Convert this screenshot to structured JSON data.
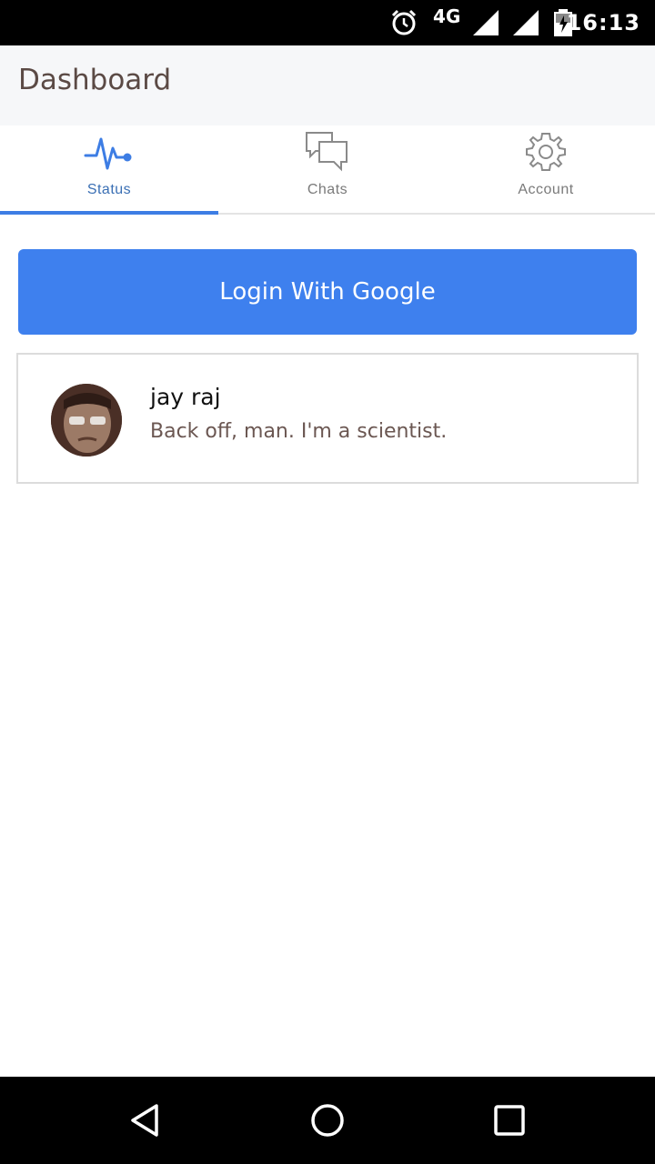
{
  "status_bar": {
    "network": "4G",
    "time": "16:13",
    "icons": [
      "alarm-icon",
      "signal-icon",
      "signal-icon",
      "battery-charging-icon"
    ]
  },
  "app_bar": {
    "title": "Dashboard"
  },
  "tabs": [
    {
      "label": "Status",
      "icon": "pulse-icon",
      "active": true
    },
    {
      "label": "Chats",
      "icon": "chat-bubbles-icon",
      "active": false
    },
    {
      "label": "Account",
      "icon": "gear-icon",
      "active": false
    }
  ],
  "login": {
    "label": "Login With Google"
  },
  "status_card": {
    "name": "jay raj",
    "status": "Back off, man. I'm a scientist."
  },
  "nav_bar": {
    "icons": [
      "back-icon",
      "home-icon",
      "recents-icon"
    ]
  },
  "colors": {
    "accent": "#3e80ee",
    "active_tab": "#3a6fb4",
    "title_text": "#5b4a45"
  }
}
